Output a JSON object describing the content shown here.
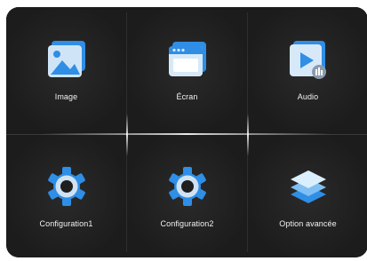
{
  "menu": {
    "items": [
      {
        "label": "Image",
        "icon": "image-icon"
      },
      {
        "label": "Écran",
        "icon": "screen-window-icon"
      },
      {
        "label": "Audio",
        "icon": "audio-play-icon"
      },
      {
        "label": "Configuration1",
        "icon": "gear-icon"
      },
      {
        "label": "Configuration2",
        "icon": "gear-icon"
      },
      {
        "label": "Option avancée",
        "icon": "layers-stack-icon"
      }
    ]
  },
  "colors": {
    "background": "#1b1b1b",
    "icon_blue": "#2f8ee6",
    "icon_light": "#d7e9f8",
    "text": "#f2f2f2"
  }
}
